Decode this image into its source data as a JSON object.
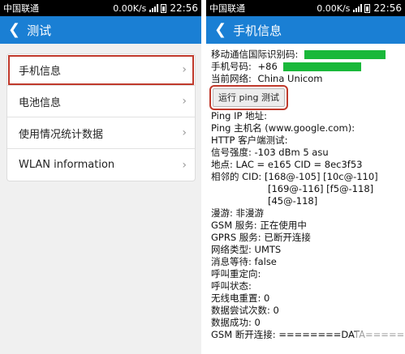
{
  "left": {
    "status": {
      "carrier": "中国联通",
      "speed": "0.00K/s",
      "time": "22:56"
    },
    "title": "测试",
    "menu": [
      {
        "label": "手机信息"
      },
      {
        "label": "电池信息"
      },
      {
        "label": "使用情况统计数据"
      },
      {
        "label": "WLAN information"
      }
    ]
  },
  "right": {
    "status": {
      "carrier": "中国联通",
      "speed": "0.00K/s",
      "time": "22:56"
    },
    "title": "手机信息",
    "imei_label": "移动通信国际识别码:",
    "phone_label": "手机号码:",
    "phone_prefix": "+86",
    "network_label": "当前网络:",
    "network_value": "China Unicom",
    "ping_button": "运行 ping 测试",
    "lines": [
      "Ping IP 地址:",
      "Ping 主机名 (www.google.com):",
      "HTTP 客户端测试:",
      "信号强度: -103 dBm   5 asu",
      "地点: LAC = e165   CID = 8ec3f53",
      "相邻的 CID:  [168@-105] [10c@-110]"
    ],
    "cid_extra": [
      "[169@-116] [f5@-118]",
      "[45@-118]"
    ],
    "lines2": [
      "漫游:   非漫游",
      "GSM 服务:   正在使用中",
      "GPRS 服务:   已断开连接",
      "网络类型:   UMTS",
      "消息等待:   false",
      "呼叫重定向:",
      "呼叫状态:",
      "无线电重置:   0",
      "数据尝试次数:   0",
      "数据成功:   0",
      "GSM 断开连接:   ========DATA========"
    ]
  }
}
